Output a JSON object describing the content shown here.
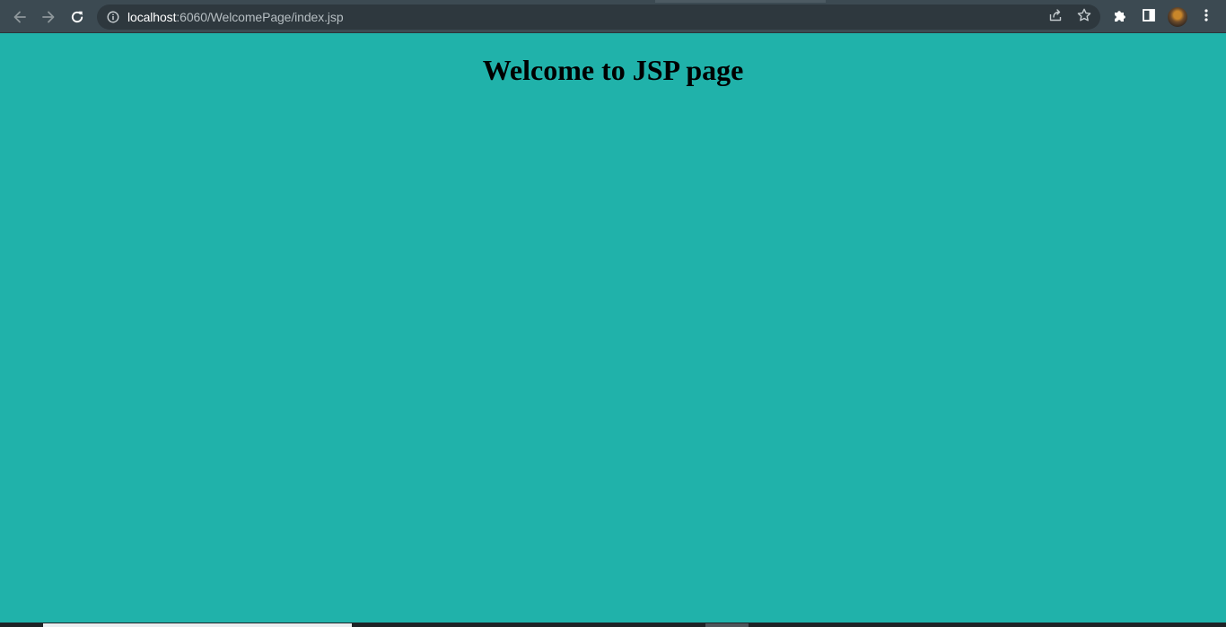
{
  "browser": {
    "url_host": "localhost",
    "url_path": ":6060/WelcomePage/index.jsp",
    "icons": {
      "back": "back-arrow-icon",
      "forward": "forward-arrow-icon",
      "reload": "reload-icon",
      "site_info": "info-icon",
      "share": "share-icon",
      "bookmark": "star-icon",
      "extensions": "puzzle-icon",
      "side_panel": "side-panel-icon",
      "profile": "avatar",
      "menu": "kebab-menu-icon"
    }
  },
  "page": {
    "heading": "Welcome to JSP page",
    "background_color": "#20b2aa"
  },
  "colors": {
    "toolbar": "#3c4a52",
    "omnibox": "#2e383e",
    "page_bg": "#20b2aa",
    "heading_text": "#000000"
  }
}
